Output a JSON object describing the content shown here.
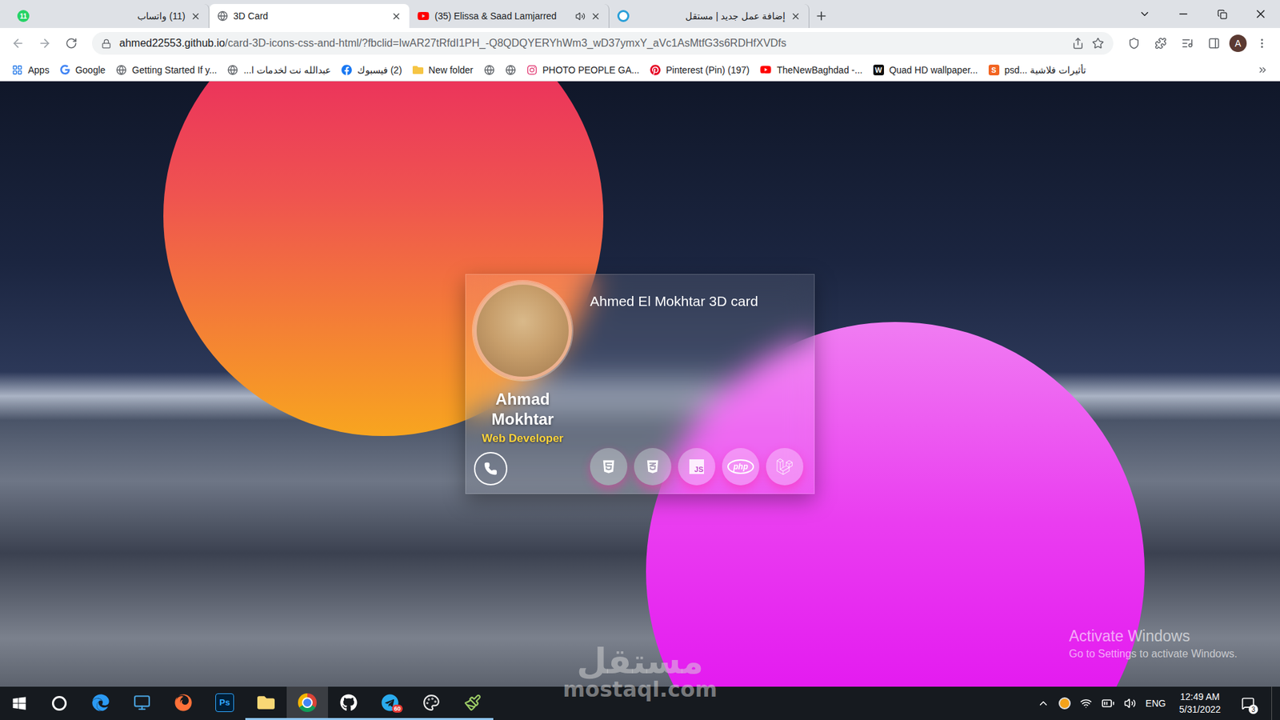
{
  "tabs": [
    {
      "label": "(11) واتساب",
      "kind": "whatsapp",
      "badge": "11",
      "playing": false,
      "selected": false
    },
    {
      "label": "3D Card",
      "kind": "globe",
      "playing": false,
      "selected": true
    },
    {
      "label": "(35) Elissa & Saad Lamjarred",
      "kind": "youtube",
      "playing": true,
      "selected": false
    },
    {
      "label": "إضافة عمل جديد | مستقل",
      "kind": "mostaql",
      "playing": false,
      "selected": false
    }
  ],
  "address": {
    "host": "ahmed22553.github.io",
    "path": "/card-3D-icons-css-and-html/?fbclid=IwAR27tRfdI1PH_-Q8QDQYERYhWm3_wD37ymxY_aVc1AsMtfG3s6RDHfXVDfs"
  },
  "profile": {
    "initial": "A"
  },
  "bookmarks": [
    {
      "kind": "apps",
      "label": "Apps"
    },
    {
      "kind": "google",
      "label": "Google"
    },
    {
      "kind": "globe",
      "label": "Getting Started If y..."
    },
    {
      "kind": "globe",
      "label": "عبدالله نت لخدمات ا..."
    },
    {
      "kind": "facebook",
      "label": "(2) فيسبوك"
    },
    {
      "kind": "folder",
      "label": "New folder"
    },
    {
      "kind": "globe",
      "label": ""
    },
    {
      "kind": "globe",
      "label": ""
    },
    {
      "kind": "instagram",
      "label": "PHOTO PEOPLE GA..."
    },
    {
      "kind": "pinterest",
      "label": "Pinterest (Pin) (197)"
    },
    {
      "kind": "youtube",
      "label": "TheNewBaghdad -..."
    },
    {
      "kind": "letter",
      "badge": "W",
      "color": "#111111",
      "label": "Quad HD wallpaper..."
    },
    {
      "kind": "letter",
      "badge": "S",
      "color": "#f26522",
      "label": "psd... تأثيرات فلاشية"
    }
  ],
  "card": {
    "title": "Ahmed El Mokhtar 3D card",
    "name": "Ahmad Mokhtar",
    "role": "Web Developer",
    "skills": [
      {
        "kind": "html"
      },
      {
        "kind": "css"
      },
      {
        "kind": "js",
        "label": "JS"
      },
      {
        "kind": "php",
        "label": "php"
      },
      {
        "kind": "laravel"
      }
    ]
  },
  "watermark": {
    "arabic": "مستقل",
    "latin": "mostaql.com"
  },
  "activation": {
    "title": "Activate Windows",
    "subtitle": "Go to Settings to activate Windows."
  },
  "taskbar": {
    "apps": [
      {
        "kind": "edge",
        "running": false,
        "selected": false
      },
      {
        "kind": "desktop",
        "running": false,
        "selected": false
      },
      {
        "kind": "firefox",
        "running": false,
        "selected": false
      },
      {
        "kind": "photoshop",
        "label": "Ps",
        "running": false,
        "selected": false
      },
      {
        "kind": "folder",
        "running": true,
        "selected": false
      },
      {
        "kind": "chrome",
        "running": true,
        "selected": true
      },
      {
        "kind": "github",
        "running": true,
        "selected": false
      },
      {
        "kind": "telegram",
        "badge": "60",
        "running": true,
        "selected": false
      },
      {
        "kind": "paint",
        "running": true,
        "selected": false
      },
      {
        "kind": "brush",
        "running": true,
        "selected": false
      }
    ],
    "tray": {
      "language": "ENG",
      "time": "12:49 AM",
      "date": "5/31/2022",
      "notifications": "3"
    }
  }
}
